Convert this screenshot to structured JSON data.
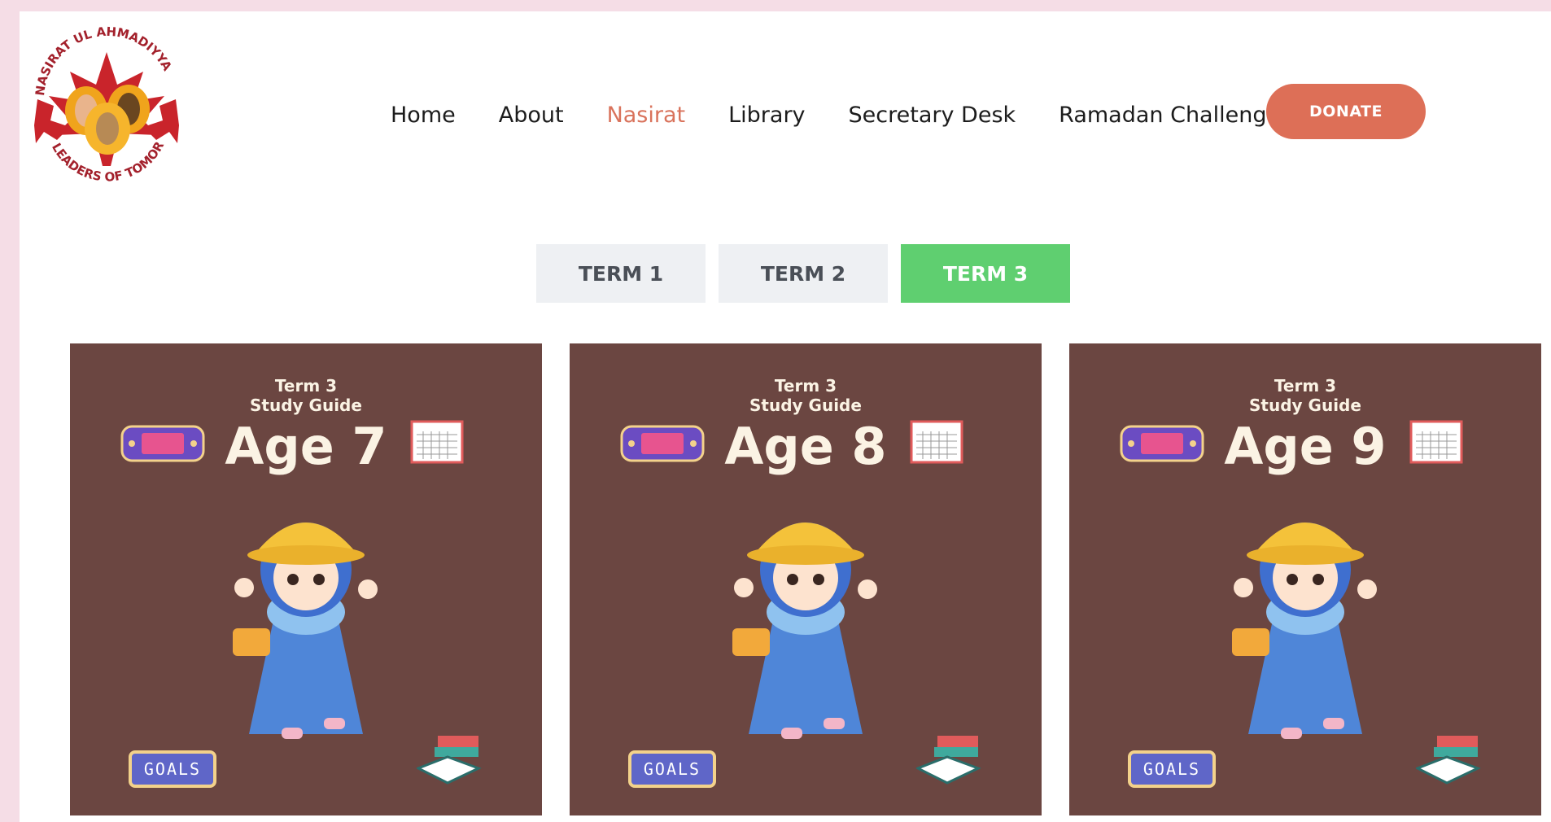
{
  "logo": {
    "top_text": "NASIRAT UL AHMADIYYA",
    "bottom_text": "LEADERS OF TOMORROW"
  },
  "nav": {
    "items": [
      {
        "label": "Home"
      },
      {
        "label": "About"
      },
      {
        "label": "Nasirat"
      },
      {
        "label": "Library"
      },
      {
        "label": "Secretary Desk"
      },
      {
        "label": "Ramadan Challenge"
      }
    ],
    "active_index": 2,
    "donate_label": "DONATE"
  },
  "tabs": [
    {
      "label": "TERM 1"
    },
    {
      "label": "TERM 2"
    },
    {
      "label": "TERM 3"
    }
  ],
  "active_tab": 2,
  "cards": [
    {
      "subtitle_line1": "Term 3",
      "subtitle_line2": "Study Guide",
      "title": "Age 7",
      "badge": "GOALS"
    },
    {
      "subtitle_line1": "Term 3",
      "subtitle_line2": "Study Guide",
      "title": "Age 8",
      "badge": "GOALS"
    },
    {
      "subtitle_line1": "Term 3",
      "subtitle_line2": "Study Guide",
      "title": "Age 9",
      "badge": "GOALS"
    }
  ],
  "colors": {
    "accent": "#dd6f57",
    "active_tab": "#5fcf70",
    "card_bg": "#6b4641"
  }
}
